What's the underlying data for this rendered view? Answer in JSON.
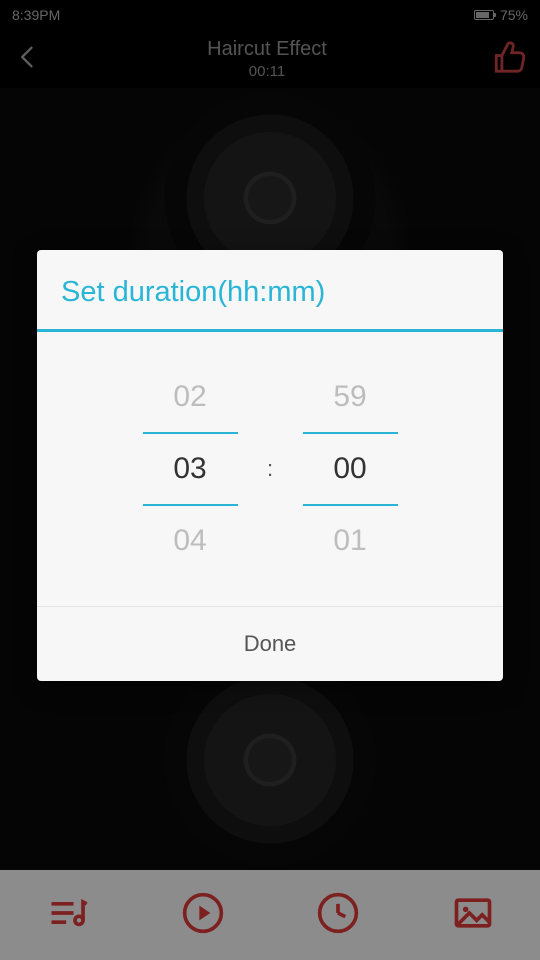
{
  "status": {
    "time": "8:39PM",
    "battery_pct": "75%"
  },
  "header": {
    "title": "Haircut Effect",
    "timestamp": "00:11"
  },
  "dialog": {
    "title": "Set duration(hh:mm)",
    "separator": ":",
    "done_label": "Done",
    "hours": {
      "prev": "02",
      "selected": "03",
      "next": "04"
    },
    "minutes": {
      "prev": "59",
      "selected": "00",
      "next": "01"
    }
  },
  "icons": {
    "back": "back-arrow",
    "like": "thumbs-up",
    "playlist": "music-list",
    "play": "play-circle",
    "clock": "clock",
    "image": "image-frame"
  }
}
